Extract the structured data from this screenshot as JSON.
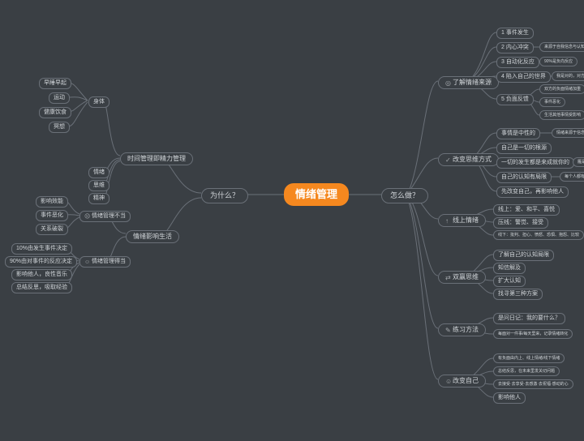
{
  "root": "情绪管理",
  "hubs": {
    "why": "为什么？",
    "how": "怎么做？"
  },
  "why": {
    "time_energy": "时间管理即精力管理",
    "body": "身体",
    "body_items": [
      "早睡早起",
      "运动",
      "健康饮食",
      "冥想"
    ],
    "emotion": "情绪",
    "thinking": "思维",
    "spirit": "精神",
    "affect_life": "情绪影响生活",
    "bad_mgmt": "情绪管理不当",
    "bad_mgmt_items": [
      "影响效能",
      "事件恶化",
      "关系破裂"
    ],
    "good_mgmt": "情绪管理得当",
    "good_mgmt_items": [
      "10%由发生事件决定",
      "90%由对事件的反应决定",
      "影响他人，良性音乐",
      "总结反思，吸取经验"
    ]
  },
  "how": {
    "source": "了解情绪来源",
    "source_items": [
      "1 事件发生",
      "2 内心冲突",
      "3 自动化反应",
      "4 陷入自己的世界",
      "5 负面反馈"
    ],
    "source_side": {
      "inner": "来源于自我信念与认知的抗拒",
      "auto": "90%是负向反应",
      "trap": "我是对的，对方是错的",
      "neg": [
        "双方的负面情绪加重",
        "事件恶化",
        "生活其他事情受影响"
      ]
    },
    "mindset": "改变思维方式",
    "mindset_items": [
      {
        "l": "事情是中性的",
        "r": "情绪来源于信念与认知系统"
      },
      {
        "l": "自己是一切的根源",
        "r": ""
      },
      {
        "l": "一切的发生都是来成就你的",
        "r": "雁是每一个菩萨"
      },
      {
        "l": "自己的认知有局限",
        "r": "每个人都有一个自己的世界"
      },
      {
        "l": "先改变自己，再影响他人",
        "r": ""
      }
    ],
    "online": "线上情绪",
    "online_items": [
      "线上：爱、和平、喜悦",
      "压线：警觉、接受",
      "线下：批判、担心、愤怒、恐惧、抱怨、比较"
    ],
    "double": "双赢思维",
    "double_items": [
      "了解自己的认知局限",
      "知信解及",
      "扩大认知",
      "找寻第三种方案"
    ],
    "practice": "练习方法",
    "practice_items": [
      "是问日记：我的要什么？",
      "每面对一件事/每天里来，记录情绪转化"
    ],
    "change": "改变自己",
    "change_items": [
      "有负面由内上、线上情绪/线下情绪",
      "总结反思，在未来里发关切问题",
      "去接受·去享受·去感激·去祝福·感动的心",
      "影响他人"
    ]
  },
  "icons": {
    "source": "◎",
    "mindset": "✓",
    "online": "↑",
    "double": "⇄",
    "practice": "✎",
    "change": "☺",
    "bad": "☹",
    "good": "☺"
  }
}
